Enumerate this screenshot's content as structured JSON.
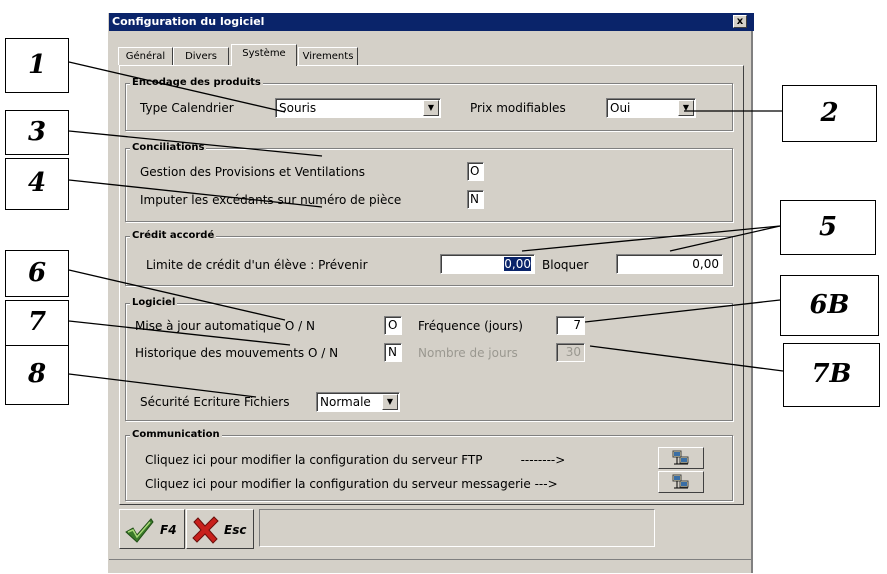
{
  "window": {
    "title": "Configuration du logiciel",
    "close_label": "x"
  },
  "tabs": [
    {
      "label": "Général"
    },
    {
      "label": "Divers"
    },
    {
      "label": "Système",
      "active": true
    },
    {
      "label": "Virements"
    }
  ],
  "encodage": {
    "group_title": "Encodage des produits",
    "type_label": "Type Calendrier",
    "type_value": "Souris",
    "prix_label": "Prix modifiables",
    "prix_value": "Oui"
  },
  "conciliations": {
    "group_title": "Conciliations",
    "gestion_label": "Gestion des Provisions et Ventilations",
    "gestion_value": "O",
    "imputer_label": "Imputer les excédants sur numéro de pièce",
    "imputer_value": "N"
  },
  "credit": {
    "group_title": "Crédit accordé",
    "limite_label": "Limite de crédit d'un élève : Prévenir",
    "prevenir_value": "0,00",
    "bloquer_label": "Bloquer",
    "bloquer_value": "0,00"
  },
  "logiciel": {
    "group_title": "Logiciel",
    "maj_label": "Mise à jour automatique O / N",
    "maj_value": "O",
    "frequence_label": "Fréquence (jours)",
    "frequence_value": "7",
    "historique_label": "Historique des mouvements O / N",
    "historique_value": "N",
    "nb_jours_label": "Nombre de jours",
    "nb_jours_value": "30",
    "securite_label": "Sécurité Ecriture Fichiers",
    "securite_value": "Normale"
  },
  "communication": {
    "group_title": "Communication",
    "ftp_label": "Cliquez ici pour modifier la configuration du serveur FTP          -------->",
    "mail_label": "Cliquez ici pour modifier la configuration du serveur messagerie --->",
    "button_icon": "network-computers-icon"
  },
  "bottom": {
    "ok_key": "F4",
    "cancel_key": "Esc",
    "ok_icon": "check-icon",
    "cancel_icon": "cross-icon"
  },
  "callouts": [
    "1",
    "2",
    "3",
    "4",
    "5",
    "6",
    "6B",
    "7",
    "7B",
    "8"
  ],
  "colors": {
    "titlebar": "#0a246a",
    "dialog_bg": "#d4d0c8",
    "selection": "#0a246a",
    "check": "#3a7a2a",
    "cross": "#c8201c"
  }
}
